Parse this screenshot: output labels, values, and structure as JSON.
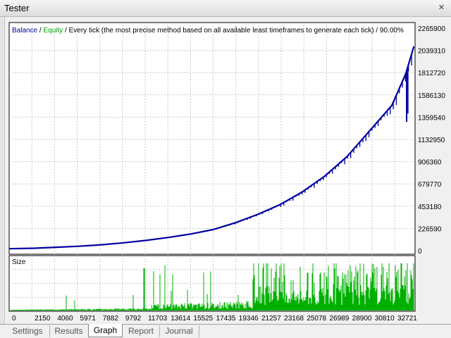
{
  "window": {
    "title": "Tester",
    "close_glyph": "✕"
  },
  "chart": {
    "legend": {
      "balance": "Balance",
      "separator": " / ",
      "equity": "Equity",
      "description": " / Every tick (the most precise method based on all available least timeframes to generate each tick) / 90.00%"
    },
    "colors": {
      "balance": "#0000a0",
      "equity": "#00a000",
      "volume": "#00b000",
      "grid": "#c8c8c8"
    },
    "size_label": "Size"
  },
  "chart_data": [
    {
      "type": "line",
      "series": [
        {
          "name": "Balance",
          "x": [
            0,
            2150,
            4060,
            5971,
            7882,
            9792,
            11703,
            13614,
            15525,
            17435,
            19346,
            21257,
            23168,
            25078,
            26989,
            28900,
            30810,
            32721,
            33900,
            34600
          ],
          "y": [
            20000,
            25000,
            35000,
            45000,
            60000,
            80000,
            105000,
            135000,
            170000,
            215000,
            285000,
            370000,
            470000,
            600000,
            760000,
            960000,
            1220000,
            1480000,
            1800000,
            2080000
          ]
        },
        {
          "name": "Equity",
          "x": [
            0,
            34600
          ],
          "y": [
            20000,
            2080000
          ]
        }
      ],
      "x_ticks": [
        "0",
        "2150",
        "4060",
        "5971",
        "7882",
        "9792",
        "11703",
        "13614",
        "15525",
        "17435",
        "19346",
        "21257",
        "23168",
        "25078",
        "26989",
        "28900",
        "30810",
        "32721"
      ],
      "y_ticks": [
        "2265900",
        "2039310",
        "1812720",
        "1586130",
        "1359540",
        "1132950",
        "906360",
        "679770",
        "453180",
        "226590",
        "0"
      ],
      "ylim": [
        0,
        2265900
      ],
      "xlim": [
        0,
        34700
      ],
      "grid": true,
      "legend": "top-left"
    },
    {
      "type": "bar",
      "title": "Size",
      "grid": true
    }
  ],
  "tabs": [
    {
      "label": "Settings"
    },
    {
      "label": "Results"
    },
    {
      "label": "Graph"
    },
    {
      "label": "Report"
    },
    {
      "label": "Journal"
    }
  ]
}
